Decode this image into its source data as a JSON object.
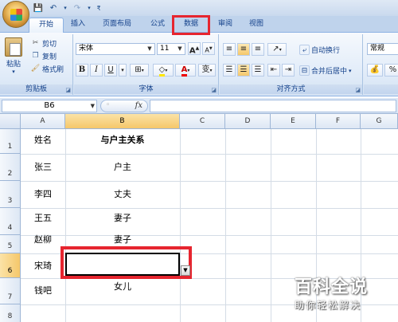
{
  "tabs": [
    {
      "label": "开始",
      "active": true
    },
    {
      "label": "插入"
    },
    {
      "label": "页面布局"
    },
    {
      "label": "公式"
    },
    {
      "label": "数据"
    },
    {
      "label": "审阅"
    },
    {
      "label": "视图"
    }
  ],
  "ribbon": {
    "clipboard": {
      "paste": "粘贴",
      "cut": "剪切",
      "copy": "复制",
      "format_painter": "格式刷",
      "label": "剪贴板"
    },
    "font": {
      "name": "宋体",
      "size": "11",
      "bold": "B",
      "italic": "I",
      "underline": "U",
      "grow": "A",
      "shrink": "A",
      "font_color_letter": "A",
      "phonetic": "变",
      "label": "字体"
    },
    "alignment": {
      "wrap_text": "自动换行",
      "merge_center": "合并后居中",
      "label": "对齐方式"
    },
    "number": {
      "format": "常规"
    }
  },
  "formula_bar": {
    "name_box": "B6",
    "fx": "fx"
  },
  "columns": [
    "A",
    "B",
    "C",
    "D",
    "E",
    "F",
    "G"
  ],
  "selected_column": "B",
  "rows": [
    "1",
    "2",
    "3",
    "4",
    "5",
    "6",
    "7",
    "8"
  ],
  "selected_row": "6",
  "cells": {
    "A1": "姓名",
    "B1": "与户主关系",
    "A2": "张三",
    "B2": "户主",
    "A3": "李四",
    "B3": "丈夫",
    "A4": "王五",
    "B4": "妻子",
    "A5": "赵柳",
    "B5": "妻子",
    "A6": "宋琦",
    "B6": "",
    "A7": "钱吧",
    "B7": "女儿"
  },
  "watermark": {
    "title": "百科全说",
    "subtitle": "助你轻松解决"
  },
  "colors": {
    "highlight": "#e6252f",
    "ribbon_bg": "#dce7f5"
  }
}
